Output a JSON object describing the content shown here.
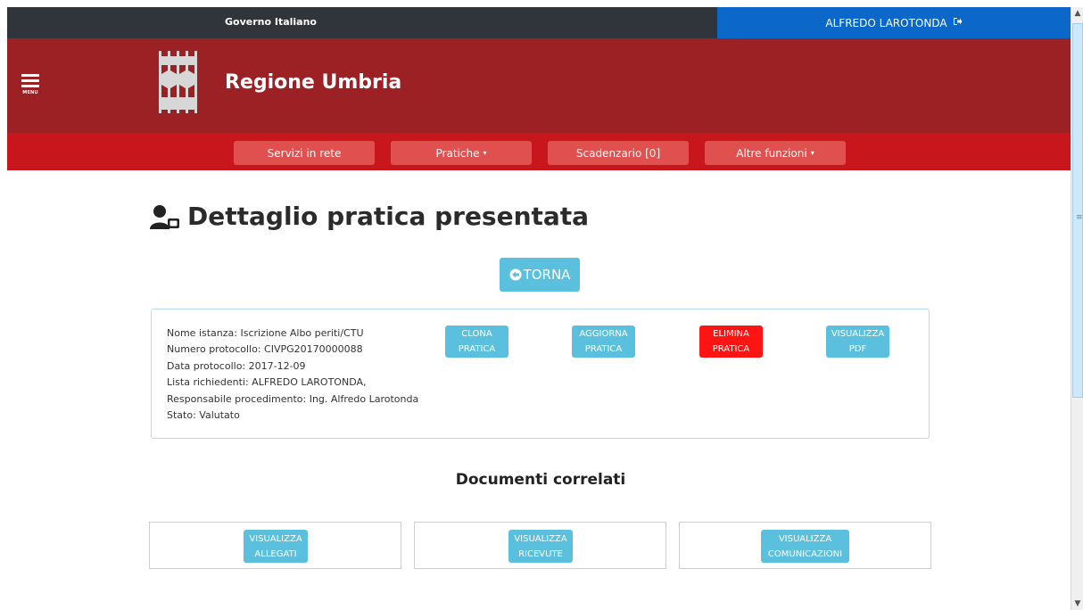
{
  "top_bar": {
    "gov_label": "Governo Italiano",
    "user_name": "ALFREDO LAROTONDA",
    "logout_icon": "sign-out-icon"
  },
  "header": {
    "menu_label": "MENU",
    "region_name": "Regione Umbria",
    "logo_icon": "regione-umbria-logo"
  },
  "nav": {
    "items": [
      {
        "label": "Servizi in rete",
        "dropdown": false
      },
      {
        "label": "Pratiche",
        "dropdown": true
      },
      {
        "label": "Scadenzario [0]",
        "dropdown": false
      },
      {
        "label": "Altre funzioni",
        "dropdown": true
      }
    ],
    "caret": "▾"
  },
  "page": {
    "title": "Dettaglio pratica presentata",
    "title_icon": "user-card-icon",
    "back_button": "TORNA",
    "back_icon": "arrow-circle-left-icon"
  },
  "detail": {
    "lines": [
      "Nome istanza: Iscrizione Albo periti/CTU",
      "Numero protocollo: CIVPG20170000088",
      "Data protocollo: 2017-12-09",
      "Lista richiedenti: ALFREDO LAROTONDA,",
      "Responsabile procedimento: Ing. Alfredo Larotonda",
      "Stato: Valutato"
    ],
    "actions": [
      {
        "line1": "CLONA",
        "line2": "PRATICA"
      },
      {
        "line1": "AGGIORNA",
        "line2": "PRATICA"
      },
      {
        "line1": "ELIMINA",
        "line2": "PRATICA"
      },
      {
        "line1": "VISUALIZZA",
        "line2": "PDF"
      }
    ]
  },
  "documents": {
    "title": "Documenti correlati",
    "buttons": [
      {
        "line1": "VISUALIZZA",
        "line2": "ALLEGATI"
      },
      {
        "line1": "VISUALIZZA",
        "line2": "RICEVUTE"
      },
      {
        "line1": "VISUALIZZA",
        "line2": "COMUNICAZIONI"
      }
    ]
  },
  "colors": {
    "gov_bar": "#2f353b",
    "user_box": "#0b67c8",
    "header": "#9b2125",
    "navbar": "#c8161d",
    "nav_item": "#e0504e",
    "info_button": "#5bc0de",
    "danger_button": "#ff1414"
  }
}
